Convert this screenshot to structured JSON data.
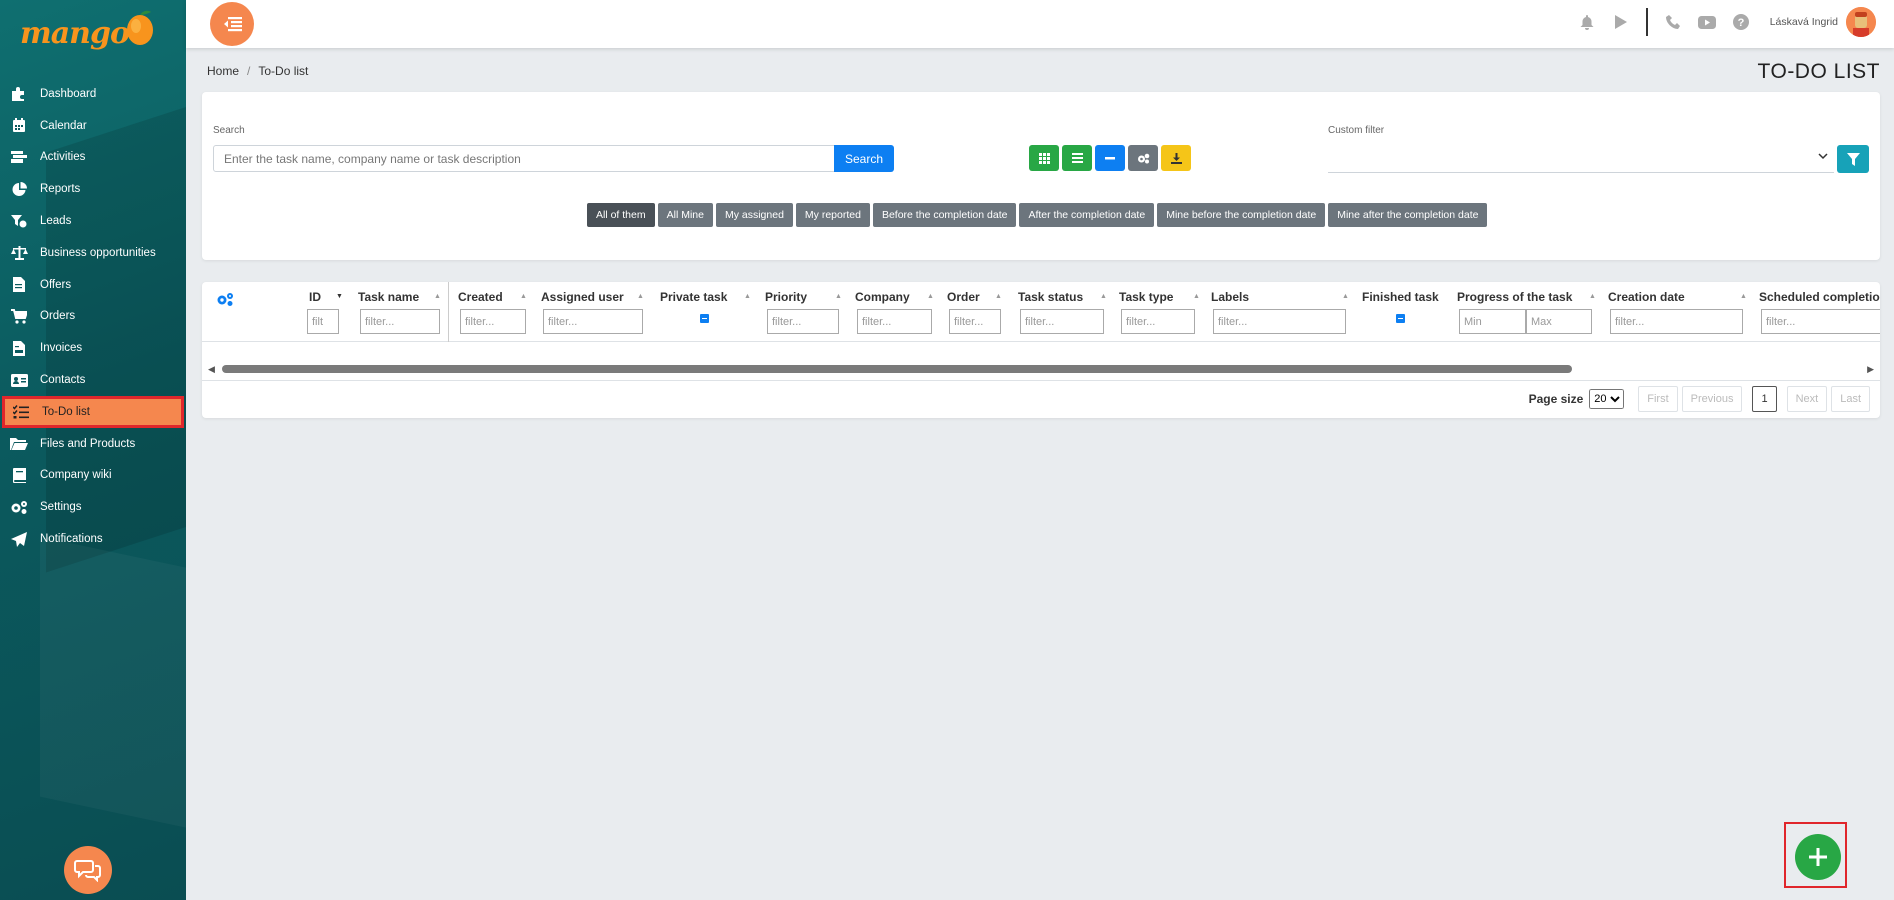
{
  "app": {
    "logo_text": "mango"
  },
  "sidebar": {
    "items": [
      {
        "label": "Dashboard",
        "icon": "puzzle-icon"
      },
      {
        "label": "Calendar",
        "icon": "calendar-icon"
      },
      {
        "label": "Activities",
        "icon": "activities-icon"
      },
      {
        "label": "Reports",
        "icon": "pie-chart-icon"
      },
      {
        "label": "Leads",
        "icon": "funnel-icon"
      },
      {
        "label": "Business opportunities",
        "icon": "scale-icon"
      },
      {
        "label": "Offers",
        "icon": "document-icon"
      },
      {
        "label": "Orders",
        "icon": "cart-icon"
      },
      {
        "label": "Invoices",
        "icon": "invoice-icon"
      },
      {
        "label": "Contacts",
        "icon": "contact-card-icon"
      },
      {
        "label": "To-Do list",
        "icon": "checklist-icon",
        "active": true
      },
      {
        "label": "Files and Products",
        "icon": "folder-icon"
      },
      {
        "label": "Company wiki",
        "icon": "book-icon"
      },
      {
        "label": "Settings",
        "icon": "gears-icon"
      },
      {
        "label": "Notifications",
        "icon": "paper-plane-icon"
      }
    ]
  },
  "topbar": {
    "user_name": "Láskavá Ingrid"
  },
  "breadcrumb": {
    "home": "Home",
    "current": "To-Do list"
  },
  "page": {
    "title": "TO-DO LIST"
  },
  "search": {
    "label": "Search",
    "placeholder": "Enter the task name, company name or task description",
    "button": "Search"
  },
  "custom_filter": {
    "label": "Custom filter",
    "value": ""
  },
  "pills": [
    "All of them",
    "All Mine",
    "My assigned",
    "My reported",
    "Before the completion date",
    "After the completion date",
    "Mine before the completion date",
    "Mine after the completion date"
  ],
  "table": {
    "columns": [
      {
        "label": "ID",
        "placeholder": "filt"
      },
      {
        "label": "Task name",
        "placeholder": "filter..."
      },
      {
        "label": "Created",
        "placeholder": "filter..."
      },
      {
        "label": "Assigned user",
        "placeholder": "filter..."
      },
      {
        "label": "Private task"
      },
      {
        "label": "Priority",
        "placeholder": "filter..."
      },
      {
        "label": "Company",
        "placeholder": "filter..."
      },
      {
        "label": "Order",
        "placeholder": "filter..."
      },
      {
        "label": "Task status",
        "placeholder": "filter..."
      },
      {
        "label": "Task type",
        "placeholder": "filter..."
      },
      {
        "label": "Labels",
        "placeholder": "filter..."
      },
      {
        "label": "Finished task"
      },
      {
        "label": "Progress of the task",
        "placeholder_min": "Min",
        "placeholder_max": "Max"
      },
      {
        "label": "Creation date",
        "placeholder": "filter..."
      },
      {
        "label": "Scheduled completio",
        "placeholder": "filter..."
      }
    ]
  },
  "pager": {
    "page_size_label": "Page size",
    "page_size": "20",
    "first": "First",
    "previous": "Previous",
    "current": "1",
    "next": "Next",
    "last": "Last"
  },
  "colors": {
    "accent": "#f5874e",
    "sidebar": "#0b5a5e",
    "primary": "#0d7ff2",
    "success": "#28a745",
    "highlight": "#e0262b"
  }
}
